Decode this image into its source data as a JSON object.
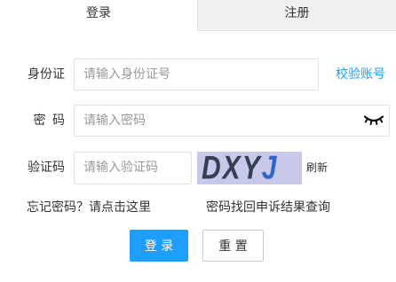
{
  "tabs": [
    {
      "label": "登录",
      "active": true
    },
    {
      "label": "注册",
      "active": false
    }
  ],
  "form": {
    "id_card": {
      "label": "身份证",
      "placeholder": "请输入身份证号"
    },
    "verify_account_link": "校验账号",
    "password": {
      "label": "密 码",
      "placeholder": "请输入密码",
      "toggle_icon": "eye-closed-icon"
    },
    "captcha": {
      "label": "验证码",
      "placeholder": "请输入验证码",
      "chars": [
        "D",
        "X",
        "Y",
        "J"
      ],
      "refresh_label": "刷新"
    },
    "forgot_password_link": "忘记密码？请点击这里",
    "appeal_query_link": "密码找回申诉结果查询",
    "login_button": "登 录",
    "reset_button": "重 置"
  },
  "colors": {
    "accent": "#1E9FFF",
    "tab_inactive_bg": "#F0F0F0",
    "captcha_bg": "#C8C8EA",
    "captcha_text": "#34404F",
    "captcha_accent": "#2E66CC"
  }
}
